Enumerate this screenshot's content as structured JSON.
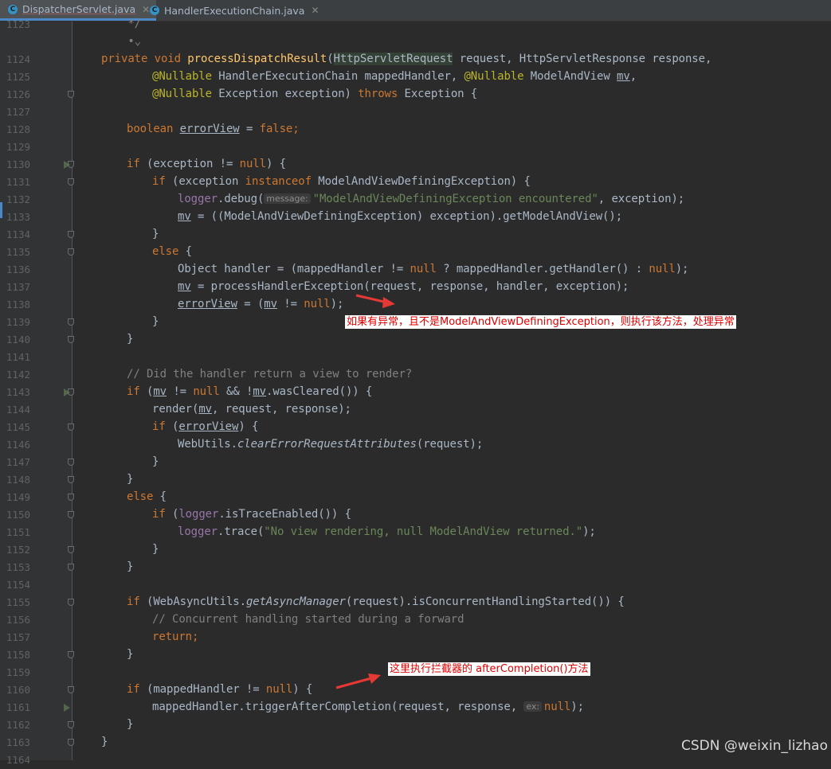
{
  "tabs": [
    {
      "label": "DispatcherServlet.java",
      "icon": "class-icon",
      "active": true
    },
    {
      "label": "HandlerExecutionChain.java",
      "icon": "class-icon",
      "active": false
    }
  ],
  "lines": [
    {
      "n": "1123",
      "i": 0,
      "p": [
        [
          "    */",
          "cm"
        ]
      ]
    },
    {
      "n": "",
      "i": 0,
      "p": [
        [
          "    •⌄",
          "cm"
        ]
      ]
    },
    {
      "n": "1124",
      "i": 0,
      "fold": false,
      "p": [
        [
          "private ",
          "kw"
        ],
        [
          "void ",
          "kw"
        ],
        [
          "processDispatchResult",
          "fn"
        ],
        [
          "(",
          ""
        ],
        [
          "HttpServletRequest",
          "param-hl"
        ],
        [
          " request, HttpServletResponse response,",
          ""
        ]
      ]
    },
    {
      "n": "1125",
      "i": 2,
      "fold": false,
      "p": [
        [
          "@Nullable ",
          "ann"
        ],
        [
          "HandlerExecutionChain mappedHandler, ",
          ""
        ],
        [
          "@Nullable ",
          "ann"
        ],
        [
          "ModelAndView ",
          ""
        ],
        [
          "mv",
          "ul"
        ],
        [
          ",",
          ""
        ]
      ]
    },
    {
      "n": "1126",
      "i": 2,
      "fold": true,
      "p": [
        [
          "@Nullable ",
          "ann"
        ],
        [
          "Exception exception) ",
          ""
        ],
        [
          "throws ",
          "kw"
        ],
        [
          "Exception {",
          ""
        ]
      ]
    },
    {
      "n": "1127",
      "i": 0,
      "p": []
    },
    {
      "n": "1128",
      "i": 1,
      "p": [
        [
          "boolean ",
          "kw"
        ],
        [
          "errorView",
          "ul"
        ],
        [
          " = ",
          ""
        ],
        [
          "false",
          "kw"
        ],
        [
          ";",
          "kw"
        ]
      ]
    },
    {
      "n": "1129",
      "i": 0,
      "p": []
    },
    {
      "n": "1130",
      "i": 1,
      "fold": true,
      "run": true,
      "p": [
        [
          "if ",
          "kw"
        ],
        [
          "(exception != ",
          ""
        ],
        [
          "null",
          "kw"
        ],
        [
          ") {",
          ""
        ]
      ]
    },
    {
      "n": "1131",
      "i": 2,
      "fold": true,
      "p": [
        [
          "if ",
          "kw"
        ],
        [
          "(exception ",
          ""
        ],
        [
          "instanceof ",
          "kw"
        ],
        [
          "ModelAndViewDefiningException) {",
          ""
        ]
      ]
    },
    {
      "n": "1132",
      "i": 3,
      "p": [
        [
          "logger",
          "fld"
        ],
        [
          ".debug(",
          ""
        ],
        [
          "message:",
          "hint"
        ],
        [
          "\"ModelAndViewDefiningException encountered\"",
          "str"
        ],
        [
          ", exception);",
          ""
        ]
      ]
    },
    {
      "n": "1133",
      "i": 3,
      "p": [
        [
          "mv",
          "ul"
        ],
        [
          " = ((ModelAndViewDefiningException) exception).getModelAndView();",
          ""
        ]
      ]
    },
    {
      "n": "1134",
      "i": 2,
      "fold": true,
      "p": [
        [
          "}",
          ""
        ]
      ]
    },
    {
      "n": "1135",
      "i": 2,
      "fold": true,
      "p": [
        [
          "else ",
          "kw"
        ],
        [
          "{",
          ""
        ]
      ]
    },
    {
      "n": "1136",
      "i": 3,
      "p": [
        [
          "Object handler = (mappedHandler != ",
          ""
        ],
        [
          "null ",
          "kw"
        ],
        [
          "? mappedHandler.getHandler() : ",
          ""
        ],
        [
          "null",
          "kw"
        ],
        [
          ");",
          ""
        ]
      ]
    },
    {
      "n": "1137",
      "i": 3,
      "p": [
        [
          "mv",
          "ul"
        ],
        [
          " = processHandlerException(request, response, handler, exception);",
          ""
        ]
      ]
    },
    {
      "n": "1138",
      "i": 3,
      "p": [
        [
          "errorView",
          "ul"
        ],
        [
          " = (",
          ""
        ],
        [
          "mv",
          "ul"
        ],
        [
          " != ",
          ""
        ],
        [
          "null",
          "kw"
        ],
        [
          ");",
          ""
        ]
      ]
    },
    {
      "n": "1139",
      "i": 2,
      "fold": true,
      "p": [
        [
          "}",
          ""
        ]
      ]
    },
    {
      "n": "1140",
      "i": 1,
      "fold": true,
      "p": [
        [
          "}",
          ""
        ]
      ]
    },
    {
      "n": "1141",
      "i": 0,
      "p": []
    },
    {
      "n": "1142",
      "i": 1,
      "p": [
        [
          "// Did the handler return a view to render?",
          "cm"
        ]
      ]
    },
    {
      "n": "1143",
      "i": 1,
      "fold": true,
      "run": true,
      "p": [
        [
          "if ",
          "kw"
        ],
        [
          "(",
          ""
        ],
        [
          "mv",
          "ul"
        ],
        [
          " != ",
          ""
        ],
        [
          "null ",
          "kw"
        ],
        [
          "&& !",
          ""
        ],
        [
          "mv",
          "ul"
        ],
        [
          ".wasCleared()) {",
          ""
        ]
      ]
    },
    {
      "n": "1144",
      "i": 2,
      "p": [
        [
          "render(",
          ""
        ],
        [
          "mv",
          "ul"
        ],
        [
          ", request, response);",
          ""
        ]
      ]
    },
    {
      "n": "1145",
      "i": 2,
      "fold": true,
      "p": [
        [
          "if ",
          "kw"
        ],
        [
          "(",
          ""
        ],
        [
          "errorView",
          "ul"
        ],
        [
          ") {",
          ""
        ]
      ]
    },
    {
      "n": "1146",
      "i": 3,
      "p": [
        [
          "WebUtils.",
          ""
        ],
        [
          "clearErrorRequestAttributes",
          "ital"
        ],
        [
          "(request);",
          ""
        ]
      ]
    },
    {
      "n": "1147",
      "i": 2,
      "fold": true,
      "p": [
        [
          "}",
          ""
        ]
      ]
    },
    {
      "n": "1148",
      "i": 1,
      "fold": true,
      "p": [
        [
          "}",
          ""
        ]
      ]
    },
    {
      "n": "1149",
      "i": 1,
      "fold": true,
      "p": [
        [
          "else ",
          "kw"
        ],
        [
          "{",
          ""
        ]
      ]
    },
    {
      "n": "1150",
      "i": 2,
      "fold": true,
      "p": [
        [
          "if ",
          "kw"
        ],
        [
          "(",
          ""
        ],
        [
          "logger",
          "fld"
        ],
        [
          ".isTraceEnabled()) {",
          ""
        ]
      ]
    },
    {
      "n": "1151",
      "i": 3,
      "p": [
        [
          "logger",
          "fld"
        ],
        [
          ".trace(",
          ""
        ],
        [
          "\"No view rendering, null ModelAndView returned.\"",
          "str"
        ],
        [
          ");",
          ""
        ]
      ]
    },
    {
      "n": "1152",
      "i": 2,
      "fold": true,
      "p": [
        [
          "}",
          ""
        ]
      ]
    },
    {
      "n": "1153",
      "i": 1,
      "fold": true,
      "p": [
        [
          "}",
          ""
        ]
      ]
    },
    {
      "n": "1154",
      "i": 0,
      "p": []
    },
    {
      "n": "1155",
      "i": 1,
      "fold": true,
      "p": [
        [
          "if ",
          "kw"
        ],
        [
          "(WebAsyncUtils.",
          ""
        ],
        [
          "getAsyncManager",
          "ital"
        ],
        [
          "(request).isConcurrentHandlingStarted()) {",
          ""
        ]
      ]
    },
    {
      "n": "1156",
      "i": 2,
      "p": [
        [
          "// Concurrent handling started during a forward",
          "cm"
        ]
      ]
    },
    {
      "n": "1157",
      "i": 2,
      "p": [
        [
          "return",
          "kw"
        ],
        [
          ";",
          "kw"
        ]
      ]
    },
    {
      "n": "1158",
      "i": 1,
      "fold": true,
      "p": [
        [
          "}",
          ""
        ]
      ]
    },
    {
      "n": "1159",
      "i": 0,
      "p": []
    },
    {
      "n": "1160",
      "i": 1,
      "fold": true,
      "p": [
        [
          "if ",
          "kw"
        ],
        [
          "(mappedHandler != ",
          ""
        ],
        [
          "null",
          "kw"
        ],
        [
          ") {",
          ""
        ]
      ]
    },
    {
      "n": "1161",
      "i": 2,
      "run": true,
      "p": [
        [
          "mappedHandler.triggerAfterCompletion(request, response, ",
          ""
        ],
        [
          "ex:",
          "hint"
        ],
        [
          "null",
          "kw"
        ],
        [
          ");",
          ""
        ]
      ]
    },
    {
      "n": "1162",
      "i": 1,
      "fold": true,
      "p": [
        [
          "}",
          ""
        ]
      ]
    },
    {
      "n": "1163",
      "i": 0,
      "fold": true,
      "p": [
        [
          "}",
          ""
        ]
      ]
    },
    {
      "n": "1164",
      "i": 0,
      "p": []
    }
  ],
  "annotations": {
    "first": "如果有异常，且不是ModelAndViewDefiningException，则执行该方法，处理异常",
    "second": "这里执行拦截器的 afterCompletion()方法"
  },
  "watermark": "CSDN @weixin_lizhao",
  "colors": {
    "keyword": "#cc7832",
    "method": "#ffc66d",
    "annotation": "#bbb529",
    "string": "#6a8759",
    "comment": "#808080",
    "field": "#9876aa",
    "arrow": "#e53935"
  }
}
